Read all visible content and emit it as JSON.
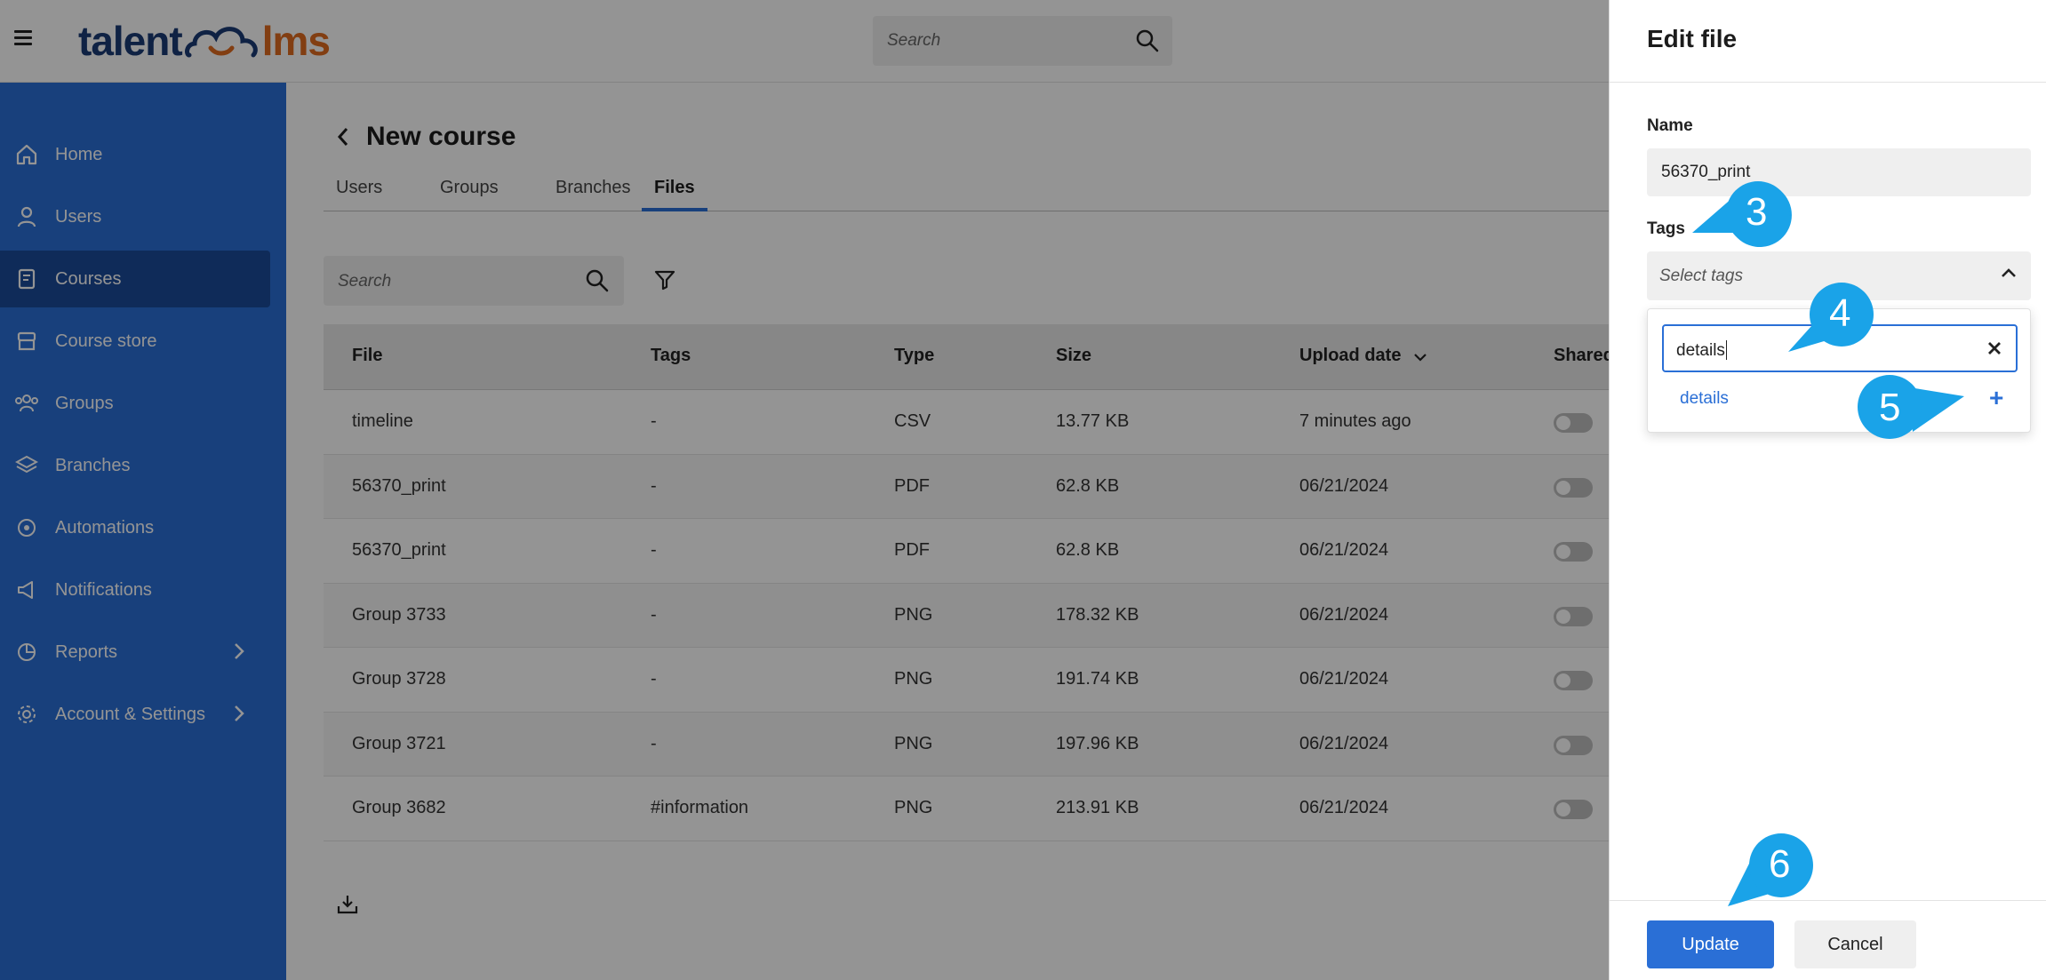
{
  "header": {
    "logo_left": "talent",
    "logo_right": "lms",
    "search_placeholder": "Search"
  },
  "sidebar": {
    "items": [
      {
        "label": "Home",
        "icon": "home-icon"
      },
      {
        "label": "Users",
        "icon": "user-icon"
      },
      {
        "label": "Courses",
        "icon": "book-icon",
        "active": true
      },
      {
        "label": "Course store",
        "icon": "store-icon"
      },
      {
        "label": "Groups",
        "icon": "groups-icon"
      },
      {
        "label": "Branches",
        "icon": "layers-icon"
      },
      {
        "label": "Automations",
        "icon": "automation-icon"
      },
      {
        "label": "Notifications",
        "icon": "megaphone-icon"
      },
      {
        "label": "Reports",
        "icon": "pie-chart-icon",
        "has_submenu": true
      },
      {
        "label": "Account & Settings",
        "icon": "gear-icon",
        "has_submenu": true
      }
    ]
  },
  "course": {
    "title": "New course",
    "tabs": [
      "Users",
      "Groups",
      "Branches",
      "Files"
    ],
    "active_tab": "Files",
    "search_placeholder": "Search"
  },
  "table": {
    "columns": [
      "File",
      "Tags",
      "Type",
      "Size",
      "Upload date",
      "Shared"
    ],
    "rows": [
      {
        "file": "timeline",
        "tags": "-",
        "type": "CSV",
        "size": "13.77 KB",
        "date": "7 minutes ago",
        "shared": false
      },
      {
        "file": "56370_print",
        "tags": "-",
        "type": "PDF",
        "size": "62.8 KB",
        "date": "06/21/2024",
        "shared": false
      },
      {
        "file": "56370_print",
        "tags": "-",
        "type": "PDF",
        "size": "62.8 KB",
        "date": "06/21/2024",
        "shared": false
      },
      {
        "file": "Group 3733",
        "tags": "-",
        "type": "PNG",
        "size": "178.32 KB",
        "date": "06/21/2024",
        "shared": false
      },
      {
        "file": "Group 3728",
        "tags": "-",
        "type": "PNG",
        "size": "191.74 KB",
        "date": "06/21/2024",
        "shared": false
      },
      {
        "file": "Group 3721",
        "tags": "-",
        "type": "PNG",
        "size": "197.96 KB",
        "date": "06/21/2024",
        "shared": false
      },
      {
        "file": "Group 3682",
        "tags": "#information",
        "type": "PNG",
        "size": "213.91 KB",
        "date": "06/21/2024",
        "shared": false
      }
    ]
  },
  "drawer": {
    "title": "Edit file",
    "name_label": "Name",
    "name_value": "56370_print",
    "tags_label": "Tags",
    "tags_placeholder": "Select tags",
    "tag_search_value": "details",
    "tag_option": "details",
    "tag_add": "+",
    "update_label": "Update",
    "cancel_label": "Cancel"
  },
  "callouts": [
    "3",
    "4",
    "5",
    "6"
  ],
  "colors": {
    "primary": "#2a6fd6",
    "sidebar": "#2a6fd6",
    "sidebar_active": "#1a4a9a",
    "logo_dark": "#1b3b76",
    "logo_orange": "#e06b1f",
    "callout": "#1aa3e8"
  }
}
